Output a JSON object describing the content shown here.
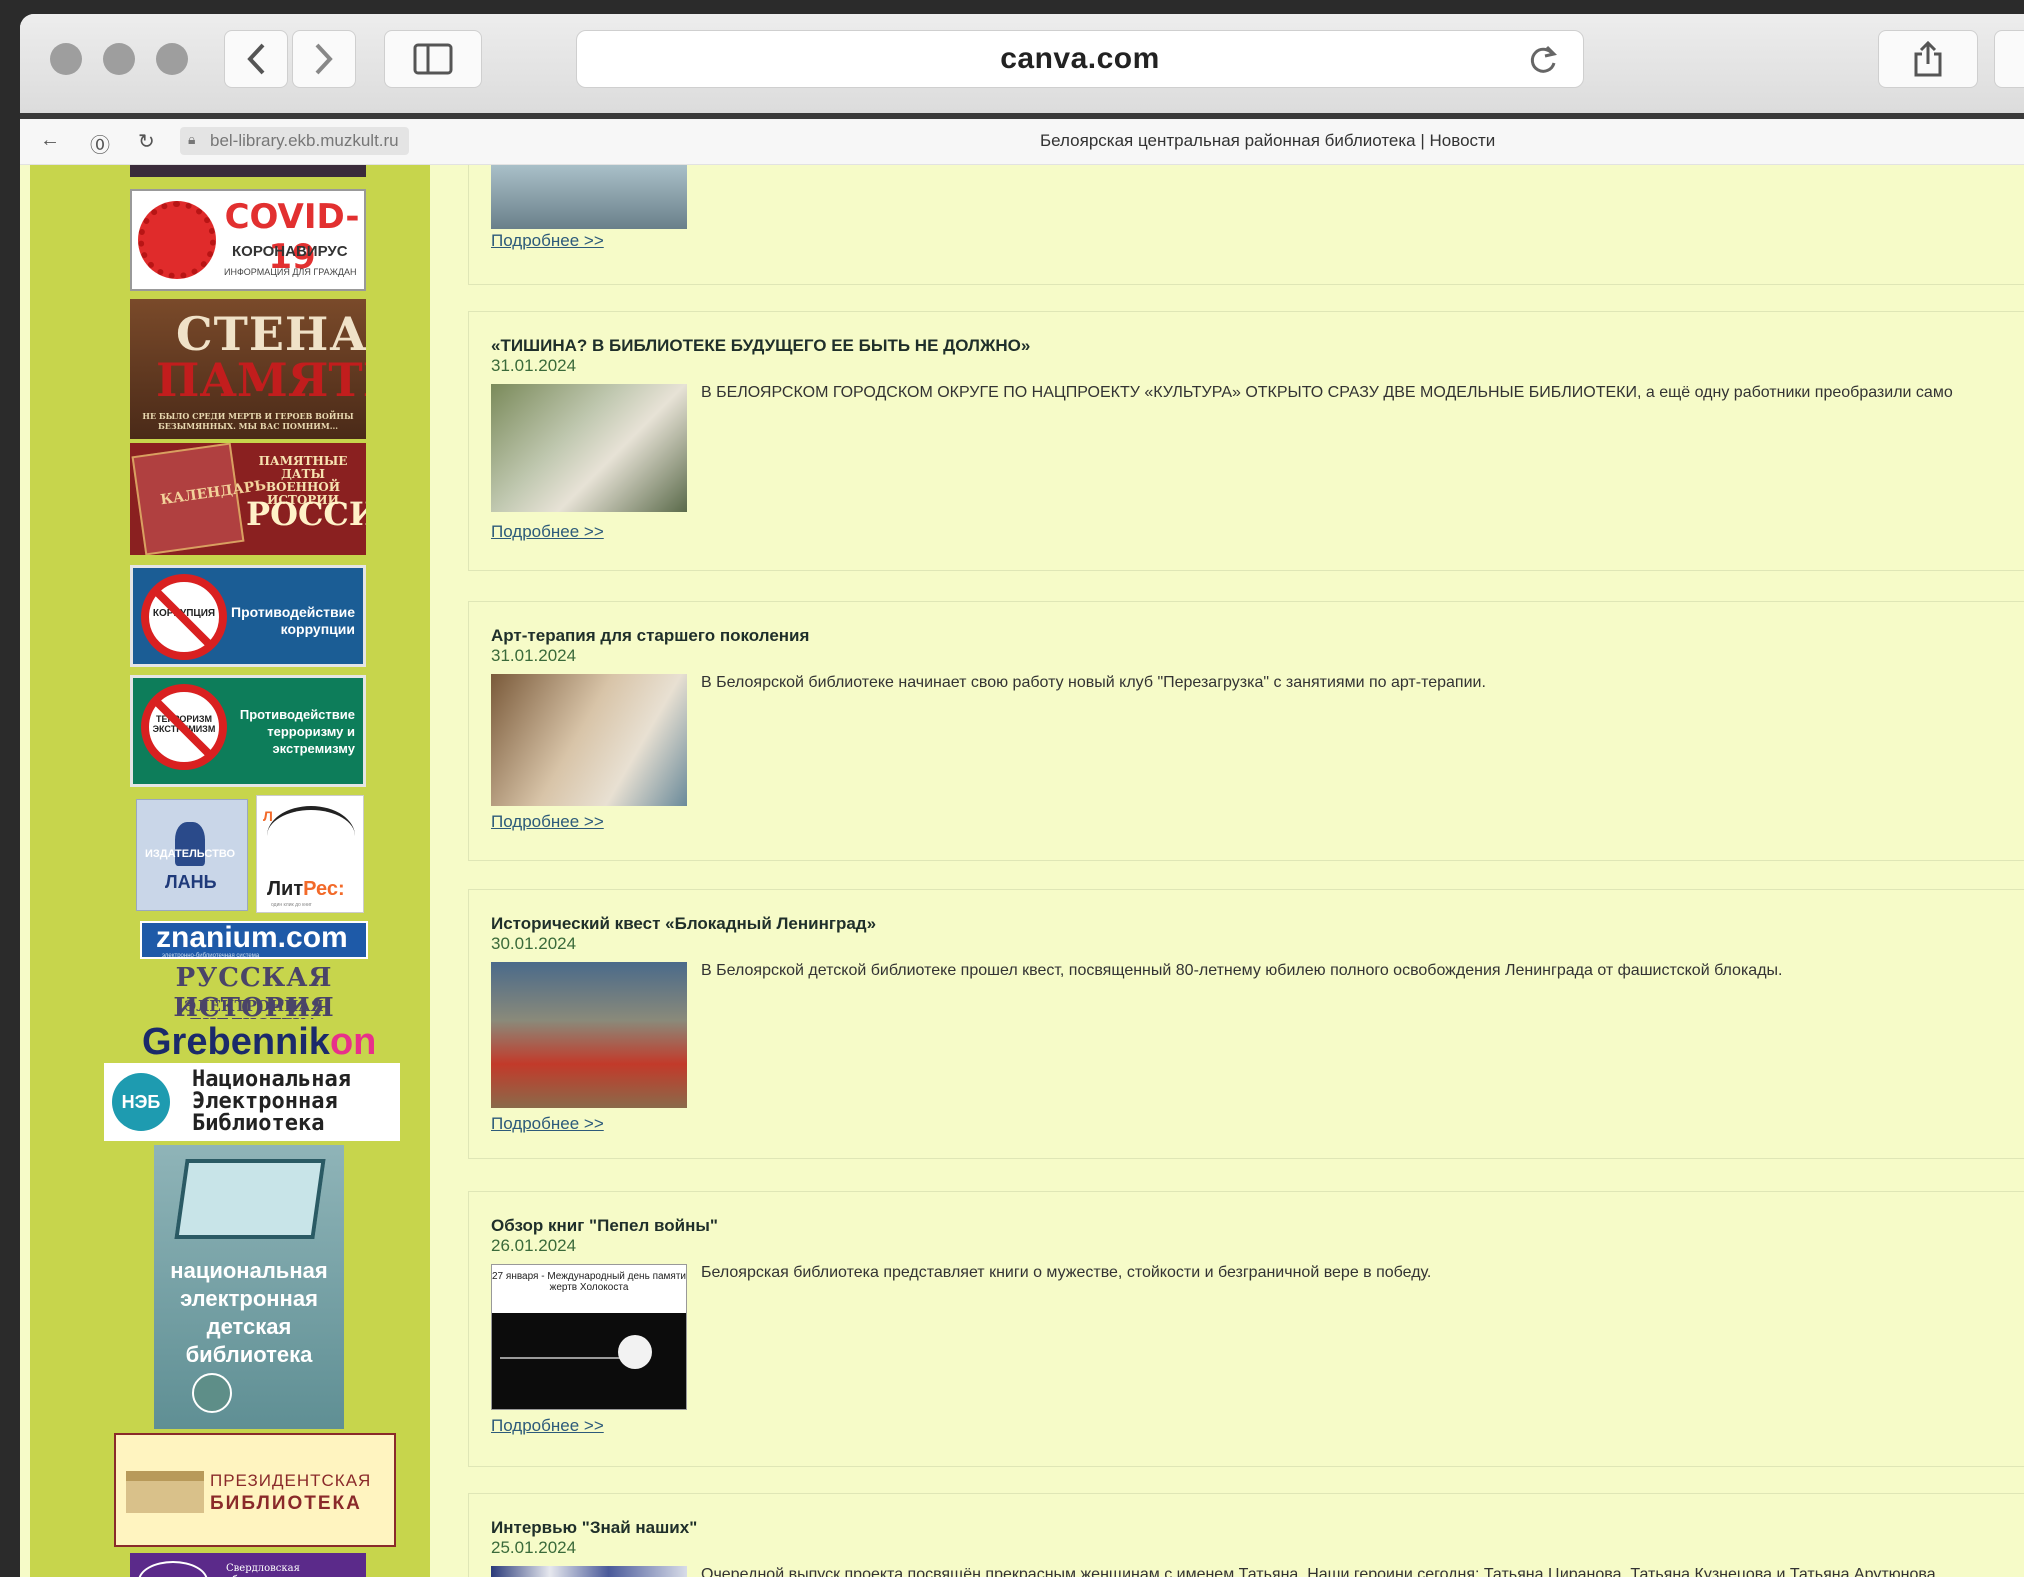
{
  "browser": {
    "url": "canva.com",
    "colors": {
      "chrome": "#e6e6e6",
      "traffic": "#9e9e9e"
    }
  },
  "inner_bar": {
    "url": "bel-library.ekb.muzkult.ru",
    "title": "Белоярская центральная районная библиотека | Новости"
  },
  "sidebar": {
    "covid": {
      "title": "COVID-19",
      "subtitle": "КОРОНАВИРУС",
      "small": "ИНФОРМАЦИЯ ДЛЯ ГРАЖДАН"
    },
    "stena": {
      "line1": "СТЕНА",
      "line2": "ПАМЯТИ",
      "small": "НЕ БЫЛО СРЕДИ МЕРТВ И ГЕРОЕВ ВОЙНЫ БЕЗЫМЯННЫХ. МЫ ВАС ПОМНИМ..."
    },
    "kalendar": {
      "book": "КАЛЕНДАРЬ",
      "dates": "ПАМЯТНЫЕ ДАТЫ ВОЕННОЙ ИСТОРИИ",
      "country": "РОССИИ"
    },
    "korr": {
      "sign": "КОРРУПЦИЯ",
      "text": "Противодействие коррупции"
    },
    "terr": {
      "sign": "ТЕРРОРИЗМ ЭКСТРЕМИЗМ",
      "text": "Противодействие терроризму и экстремизму"
    },
    "lan": {
      "izd": "ИЗДАТЕЛЬСТВО",
      "name": "ЛАНЬ"
    },
    "litres": {
      "letter": "Л",
      "name_a": "Лит",
      "name_b": "Рес:",
      "sub": "один клик до книг"
    },
    "znanium": {
      "name": "znanium.com",
      "sub": "электронно-библиотечная система"
    },
    "russ": {
      "line1": "РУССКАЯ ИСТОРИЯ",
      "line2": "ЭЛЕКТРОННАЯ БИБЛИОТЕКА"
    },
    "greb": {
      "a": "Grebennik",
      "b": "on"
    },
    "neb": {
      "abbr": "НЭБ",
      "l1": "Национальная",
      "l2": "Электронная",
      "l3": "Библиотека"
    },
    "ndb": {
      "l1": "национальная",
      "l2": "электронная",
      "l3": "детская",
      "l4": "библиотека"
    },
    "pres": {
      "l1": "ПРЕЗИДЕНТСКАЯ",
      "l2": "БИБЛИОТЕКА"
    },
    "sverd": {
      "text": "Свердловская областная специальная библиотека"
    }
  },
  "news": {
    "more_label": "Подробнее >>",
    "items": [
      {
        "title": "«ТИШИНА? В БИБЛИОТЕКЕ БУДУЩЕГО ЕЕ БЫТЬ НЕ ДОЛЖНО»",
        "date": "31.01.2024",
        "desc": "В БЕЛОЯРСКОМ ГОРОДСКОМ ОКРУГЕ ПО НАЦПРОЕКТУ «КУЛЬТУРА» ОТКРЫТО СРАЗУ ДВЕ МОДЕЛЬНЫЕ БИБЛИОТЕКИ, а ещё одну работники преобразили само"
      },
      {
        "title": "Арт-терапия для старшего поколения",
        "date": "31.01.2024",
        "desc": "В Белоярской библиотеке начинает свою работу новый клуб \"Перезагрузка\" с занятиями по арт-терапии."
      },
      {
        "title": "Исторический квест «Блокадный Ленинград»",
        "date": "30.01.2024",
        "desc": "В Белоярской детской библиотеке прошел квест, посвященный 80-летнему юбилею полного освобождения Ленинграда от фашистской блокады."
      },
      {
        "title": "Обзор книг \"Пепел войны\"",
        "date": "26.01.2024",
        "desc": "Белоярская библиотека представляет книги о мужестве, стойкости и безграничной вере в победу.",
        "thumb_text": "27 января - Международный день памяти жертв Холокоста"
      },
      {
        "title": "Интервью \"Знай наших\"",
        "date": "25.01.2024",
        "desc": "Очередной выпуск проекта посвящён прекрасным женщинам с именем Татьяна. Наши героини сегодня: Татьяна Циранова, Татьяна Кузнецова и Татьяна Арутюнова."
      }
    ]
  }
}
